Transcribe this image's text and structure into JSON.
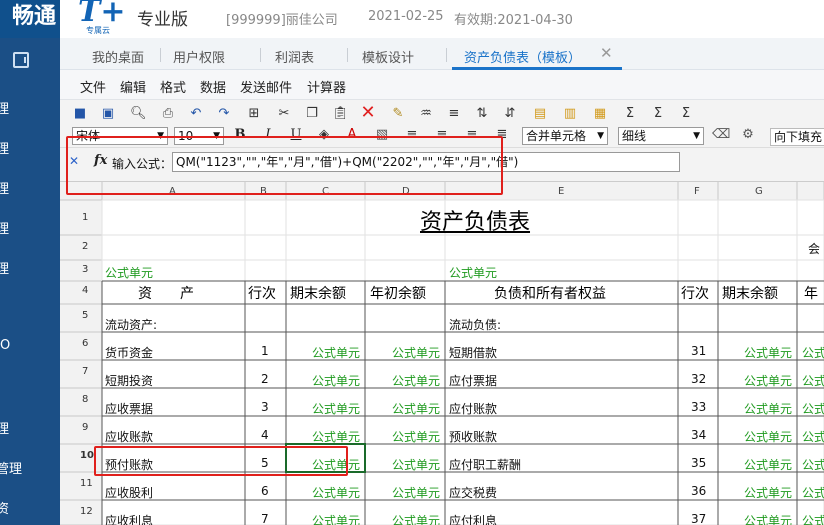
{
  "header": {
    "brand_left": "畅通",
    "logo_main": "T+",
    "logo_sub": "专属云",
    "edition": "专业版",
    "company": "[999999]丽佳公司",
    "date": "2021-02-25",
    "valid": "有效期:2021-04-30"
  },
  "sidebar": {
    "items": [
      "理",
      "理",
      "理",
      "理",
      "理",
      "O",
      "理",
      "管理",
      "资"
    ]
  },
  "tabs": [
    {
      "label": "我的桌面",
      "active": false
    },
    {
      "label": "用户权限",
      "active": false
    },
    {
      "label": "利润表",
      "active": false
    },
    {
      "label": "模板设计",
      "active": false
    },
    {
      "label": "资产负债表（模板）",
      "active": true
    }
  ],
  "menu": [
    "文件",
    "编辑",
    "格式",
    "数据",
    "发送邮件",
    "计算器"
  ],
  "toolbar": {
    "font_name": "宋体",
    "font_size": "10",
    "merge_select": "合并单元格",
    "border_select": "细线",
    "fill_down_label": "向下填充"
  },
  "formula": {
    "label": "输入公式：",
    "value": "QM(\"1123\",\"\",\"年\",\"月\",\"借\")+QM(\"2202\",\"\",\"年\",\"月\",\"借\")"
  },
  "sheet": {
    "col_headers": [
      "A",
      "B",
      "C",
      "D",
      "E",
      "F",
      "G"
    ],
    "row_headers": [
      "1",
      "2",
      "3",
      "4",
      "5",
      "6",
      "7",
      "8",
      "9",
      "10",
      "11",
      "12"
    ],
    "title": "资产负债表",
    "row2_right": "会",
    "formula_label": "公式单元",
    "headers": {
      "asset": "资　　产",
      "line": "行次",
      "end_bal": "期末余额",
      "begin_bal": "年初余额",
      "liab": "负债和所有者权益",
      "line2": "行次",
      "end_bal2": "期末余额",
      "year_partial": "年"
    },
    "current_assets": "流动资产:",
    "current_liab": "流动负债:",
    "rows": [
      {
        "a": "货币资金",
        "b": "1",
        "e": "短期借款",
        "f": "31"
      },
      {
        "a": "短期投资",
        "b": "2",
        "e": "应付票据",
        "f": "32"
      },
      {
        "a": "应收票据",
        "b": "3",
        "e": "应付账款",
        "f": "33"
      },
      {
        "a": "应收账款",
        "b": "4",
        "e": "预收账款",
        "f": "34"
      },
      {
        "a": "预付账款",
        "b": "5",
        "e": "应付职工薪酬",
        "f": "35"
      },
      {
        "a": "应收股利",
        "b": "6",
        "e": "应交税费",
        "f": "36"
      },
      {
        "a": "应收利息",
        "b": "7",
        "e": "应付利息",
        "f": "37"
      }
    ]
  },
  "colors": {
    "sidebar": "#1b4f86",
    "tab_active": "#1a73c9",
    "formula_green": "#1f9a1f",
    "highlight_red": "#e0201c"
  }
}
